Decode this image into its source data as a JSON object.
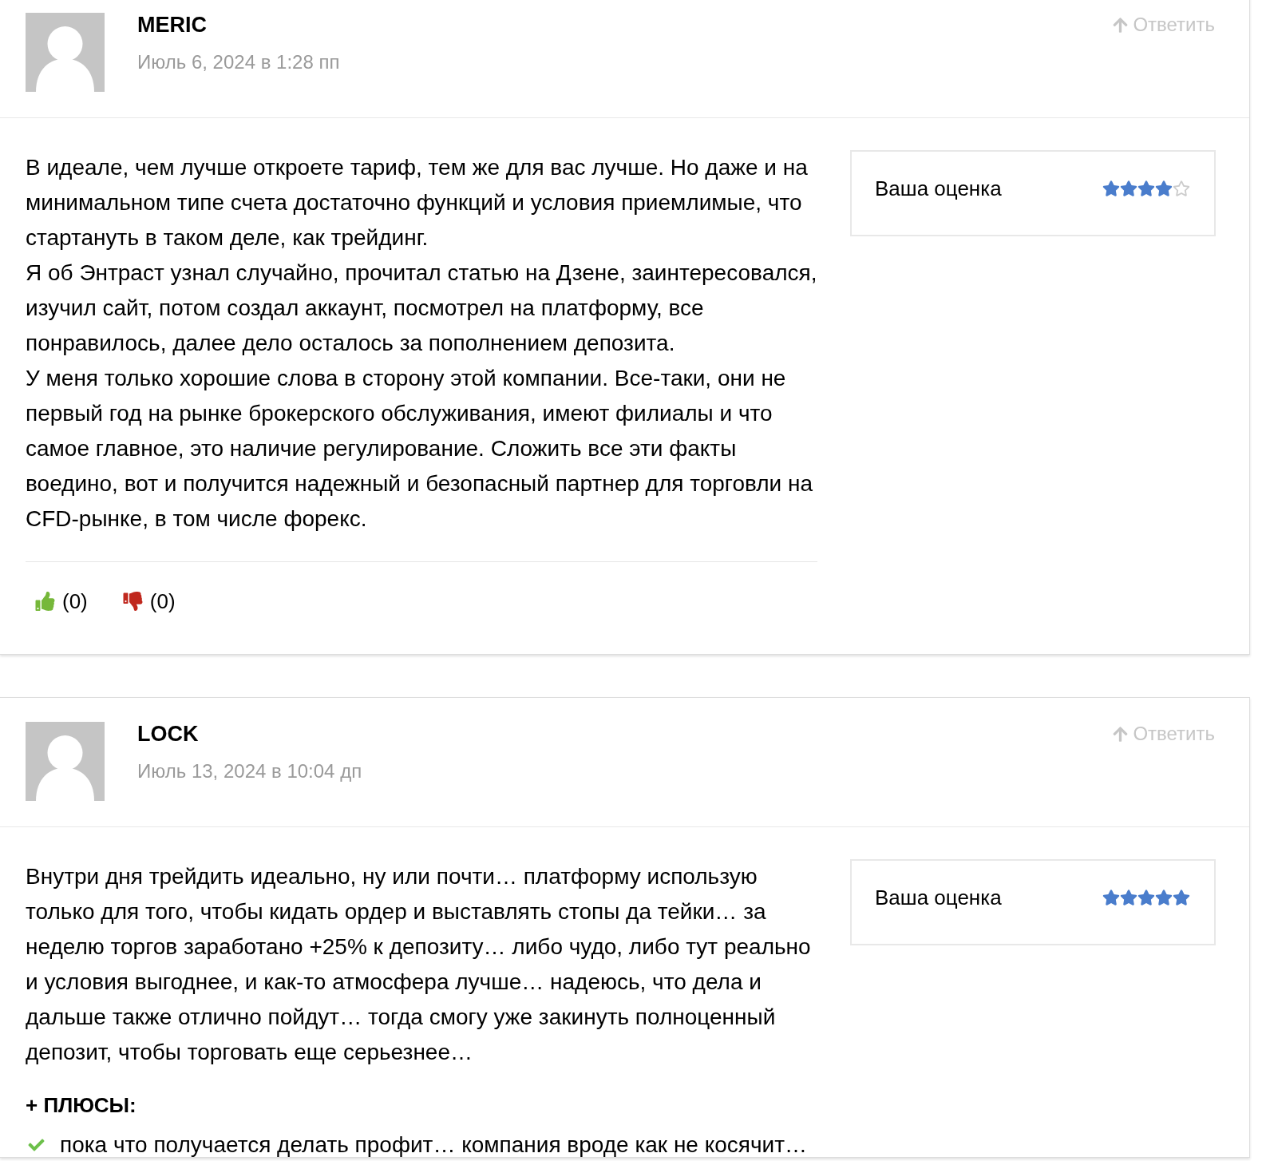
{
  "comments": [
    {
      "author": "MERIC",
      "date": "Июль 6, 2024 в 1:28 пп",
      "reply": "Ответить",
      "paragraphs": [
        "В идеале, чем лучше откроете тариф, тем же для вас лучше. Но даже и на минимальном типе счета достаточно функций и условия приемлимые, что стартануть в таком деле, как трейдинг.",
        "Я об Энтраст узнал случайно, прочитал статью на Дзене, заинтересовался, изучил сайт, потом создал аккаунт, посмотрел на платформу, все понравилось, далее дело осталось за пополнением депозита.",
        "У меня только хорошие слова в сторону этой компании. Все-таки, они не первый год на рынке брокерского обслуживания, имеют филиалы и что самое главное, это наличие регулирование. Сложить все эти факты воедино, вот и получится надежный и безопасный партнер для торговли на CFD-рынке, в том числе форекс."
      ],
      "rating": {
        "label": "Ваша оценка",
        "stars": 4
      },
      "votes": {
        "likes": "(0)",
        "dislikes": "(0)"
      }
    },
    {
      "author": "LOCK",
      "date": "Июль 13, 2024 в 10:04 дп",
      "reply": "Ответить",
      "paragraphs": [
        "Внутри дня трейдить идеально, ну или почти… платформу использую только для того, чтобы кидать ордер и выставлять стопы да тейки… за неделю торгов заработано +25% к депозиту… либо чудо, либо тут реально и условия выгоднее, и как-то атмосфера лучше… надеюсь, что дела и дальше также отлично пойдут… тогда смогу уже закинуть полноценный депозит, чтобы торговать еще серьезнее…"
      ],
      "rating": {
        "label": "Ваша оценка",
        "stars": 5
      },
      "pros": {
        "heading": "+ ПЛЮСЫ:",
        "items": [
          "пока что получается делать профит… компания вроде как не косячит…"
        ]
      }
    }
  ]
}
